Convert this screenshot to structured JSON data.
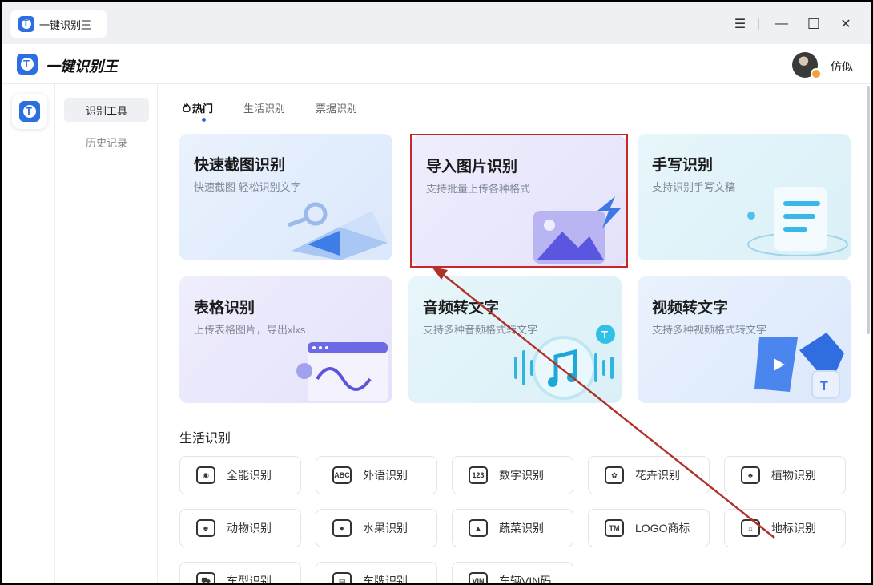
{
  "window": {
    "tab_title": "一键识别王",
    "controls": {
      "menu": "☰",
      "minimize": "—",
      "maximize": "☐",
      "close": "✕"
    }
  },
  "header": {
    "app_title": "一键识别王",
    "username": "仿似"
  },
  "sidebar": {
    "items": [
      {
        "label": "识别工具",
        "active": true
      },
      {
        "label": "历史记录",
        "active": false
      }
    ]
  },
  "category_tabs": [
    {
      "label": "热门",
      "active": true,
      "icon": "fire-icon"
    },
    {
      "label": "生活识别",
      "active": false
    },
    {
      "label": "票据识别",
      "active": false
    }
  ],
  "feature_cards": [
    {
      "title": "快速截图识别",
      "subtitle": "快速截图 轻松识别文字"
    },
    {
      "title": "导入图片识别",
      "subtitle": "支持批量上传各种格式"
    },
    {
      "title": "手写识别",
      "subtitle": "支持识别手写文稿"
    },
    {
      "title": "表格识别",
      "subtitle": "上传表格图片，导出xlxs"
    },
    {
      "title": "音频转文字",
      "subtitle": "支持多种音频格式转文字"
    },
    {
      "title": "视频转文字",
      "subtitle": "支持多种视频格式转文字"
    }
  ],
  "life_section": {
    "title": "生活识别",
    "tools": [
      {
        "label": "全能识别",
        "icon": "eye-scan-icon",
        "glyph": "◉"
      },
      {
        "label": "外语识别",
        "icon": "abc-scan-icon",
        "glyph": "ABC"
      },
      {
        "label": "数字识别",
        "icon": "number-scan-icon",
        "glyph": "123"
      },
      {
        "label": "花卉识别",
        "icon": "flower-scan-icon",
        "glyph": "✿"
      },
      {
        "label": "植物识别",
        "icon": "plant-scan-icon",
        "glyph": "♣"
      },
      {
        "label": "动物识别",
        "icon": "animal-scan-icon",
        "glyph": "☻"
      },
      {
        "label": "水果识别",
        "icon": "fruit-scan-icon",
        "glyph": "●"
      },
      {
        "label": "蔬菜识别",
        "icon": "vegetable-scan-icon",
        "glyph": "▲"
      },
      {
        "label": "LOGO商标",
        "icon": "logo-scan-icon",
        "glyph": "TM"
      },
      {
        "label": "地标识别",
        "icon": "landmark-scan-icon",
        "glyph": "⌂"
      },
      {
        "label": "车型识别",
        "icon": "car-scan-icon",
        "glyph": "⛟"
      },
      {
        "label": "车牌识别",
        "icon": "plate-scan-icon",
        "glyph": "▤"
      },
      {
        "label": "车辆VIN码",
        "icon": "vin-scan-icon",
        "glyph": "VIN"
      }
    ]
  },
  "annotation": {
    "highlight_color": "#c4282a",
    "arrow_color": "#b03128"
  }
}
